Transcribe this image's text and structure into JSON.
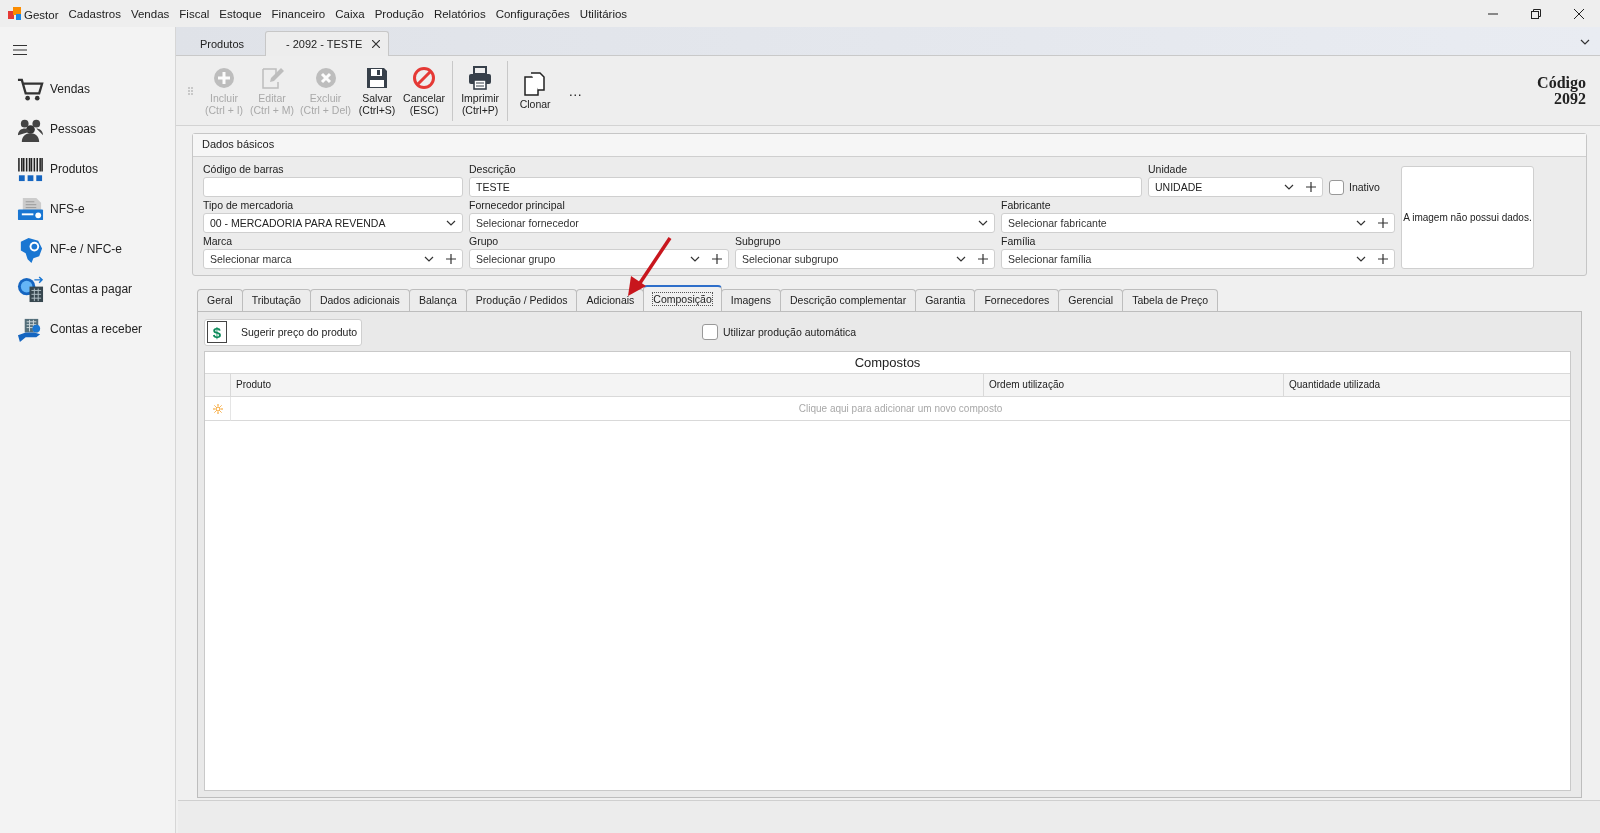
{
  "menu_bar": {
    "app_name": "Gestor",
    "items": [
      "Cadastros",
      "Vendas",
      "Fiscal",
      "Estoque",
      "Financeiro",
      "Caixa",
      "Produção",
      "Relatórios",
      "Configurações",
      "Utilitários"
    ]
  },
  "sidebar": {
    "items": [
      {
        "label": "Vendas",
        "kind": "cart"
      },
      {
        "label": "Pessoas",
        "kind": "people"
      },
      {
        "label": "Produtos",
        "kind": "barcode"
      },
      {
        "label": "NFS-e",
        "kind": "document"
      },
      {
        "label": "NF-e / NFC-e",
        "kind": "map"
      },
      {
        "label": "Contas a pagar",
        "kind": "calculator"
      },
      {
        "label": "Contas a receber",
        "kind": "hand"
      }
    ]
  },
  "document_tabs": [
    {
      "label": "Produtos",
      "selected": false,
      "closable": false
    },
    {
      "label": "- 2092 - TESTE",
      "selected": true,
      "closable": true
    }
  ],
  "toolbar": {
    "buttons": [
      {
        "label": "Incluir",
        "shortcut": "(Ctrl + I)",
        "kind": "add",
        "disabled": true,
        "separator_before": false
      },
      {
        "label": "Editar",
        "shortcut": "(Ctrl + M)",
        "kind": "edit",
        "disabled": true,
        "separator_before": false
      },
      {
        "label": "Excluir",
        "shortcut": "(Ctrl + Del)",
        "kind": "delete",
        "disabled": true,
        "separator_before": false
      },
      {
        "label": "Salvar",
        "shortcut": "(Ctrl+S)",
        "kind": "save",
        "disabled": false,
        "separator_before": false
      },
      {
        "label": "Cancelar",
        "shortcut": "(ESC)",
        "kind": "cancel",
        "disabled": false,
        "separator_before": false
      },
      {
        "label": "Imprimir",
        "shortcut": "(Ctrl+P)",
        "kind": "print",
        "disabled": false,
        "separator_before": true
      },
      {
        "label": "Clonar",
        "kind": "clone",
        "disabled": false,
        "separator_before": true
      }
    ],
    "more": "…"
  },
  "record_code": {
    "label": "Código",
    "value": "2092"
  },
  "basic_data": {
    "title": "Dados básicos",
    "fields": [
      {
        "label": "Código de barras",
        "kind": "text"
      },
      {
        "label": "Descrição",
        "kind": "text",
        "value": "TESTE"
      },
      {
        "label": "Unidade",
        "kind": "dropdown_add",
        "value": "UNIDADE"
      },
      {
        "label": "Tipo de mercadoria",
        "kind": "dropdown",
        "value": "00 - MERCADORIA PARA REVENDA"
      },
      {
        "label": "Fornecedor principal",
        "kind": "dropdown",
        "placeholder": "Selecionar fornecedor"
      },
      {
        "label": "Fabricante",
        "kind": "dropdown_add",
        "placeholder": "Selecionar fabricante"
      },
      {
        "label": "Marca",
        "kind": "dropdown_add",
        "placeholder": "Selecionar marca"
      },
      {
        "label": "Grupo",
        "kind": "dropdown_add",
        "placeholder": "Selecionar grupo"
      },
      {
        "label": "Subgrupo",
        "kind": "dropdown_add",
        "placeholder": "Selecionar subgrupo"
      },
      {
        "label": "Família",
        "kind": "dropdown_add",
        "placeholder": "Selecionar família"
      }
    ],
    "inactive": {
      "label": "Inativo",
      "checked": false
    },
    "image_message": "A imagem não possui dados."
  },
  "section_tabs": [
    {
      "label": "Geral",
      "selected": false
    },
    {
      "label": "Tributação",
      "selected": false
    },
    {
      "label": "Dados adicionais",
      "selected": false
    },
    {
      "label": "Balança",
      "selected": false
    },
    {
      "label": "Produção / Pedidos",
      "selected": false
    },
    {
      "label": "Adicionais",
      "selected": false
    },
    {
      "label": "Composição",
      "selected": true
    },
    {
      "label": "Imagens",
      "selected": false
    },
    {
      "label": "Descrição complementar",
      "selected": false
    },
    {
      "label": "Garantia",
      "selected": false
    },
    {
      "label": "Fornecedores",
      "selected": false
    },
    {
      "label": "Gerencial",
      "selected": false
    },
    {
      "label": "Tabela de Preço",
      "selected": false
    }
  ],
  "composition": {
    "suggest_button": {
      "icon_glyph": "$",
      "label": "Sugerir preço do produto"
    },
    "auto_production": {
      "label": "Utilizar produção automática",
      "checked": false
    },
    "grid": {
      "title": "Compostos",
      "columns": [
        "Produto",
        "Ordem utilização",
        "Quantidade utilizada"
      ],
      "new_row_hint": "Clique aqui para adicionar um novo composto"
    }
  }
}
